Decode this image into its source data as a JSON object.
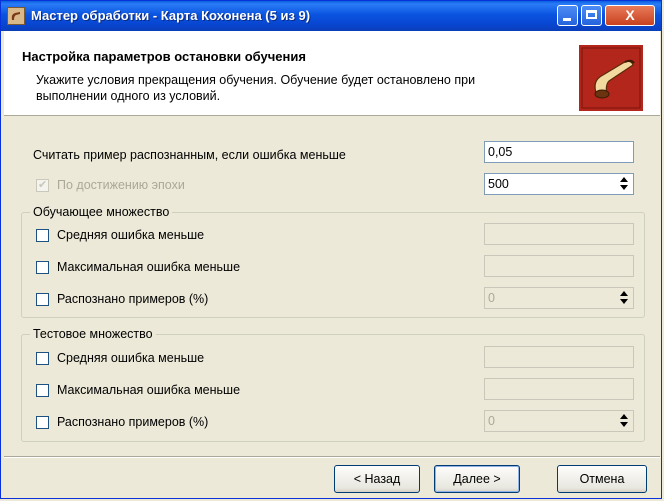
{
  "window": {
    "title": "Мастер обработки - Карта Кохонена (5 из 9)",
    "close_glyph": "X"
  },
  "header": {
    "title": "Настройка параметров остановки обучения",
    "description": "Укажите условия прекращения обучения. Обучение будет остановлено при выполнении одного из условий."
  },
  "recognition": {
    "label": "Считать пример распознанным, если ошибка меньше",
    "value": "0,05"
  },
  "epoch": {
    "label": "По достижению эпохи",
    "checked": true,
    "disabled": true,
    "value": "500"
  },
  "training_set": {
    "legend": "Обучающее множество",
    "avg_error_label": "Средняя ошибка меньше",
    "avg_error_value": "",
    "max_error_label": "Максимальная ошибка меньше",
    "max_error_value": "",
    "recognized_label": "Распознано примеров (%)",
    "recognized_value": "0"
  },
  "test_set": {
    "legend": "Тестовое множество",
    "avg_error_label": "Средняя ошибка меньше",
    "avg_error_value": "",
    "max_error_label": "Максимальная ошибка меньше",
    "max_error_value": "",
    "recognized_label": "Распознано примеров (%)",
    "recognized_value": "0"
  },
  "buttons": {
    "back": "< Назад",
    "next": "Далее >",
    "cancel": "Отмена"
  },
  "icons": {
    "app": "app-logo-icon",
    "wizard": "pipe-logo-icon"
  },
  "colors": {
    "titlebar": "#0a54e0",
    "logo_red": "#c0281c",
    "dialog_bg": "#ece9d8"
  }
}
